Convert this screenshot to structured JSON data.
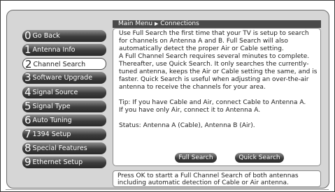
{
  "menu": {
    "items": [
      {
        "number": "0",
        "label": "Go Back"
      },
      {
        "number": "1",
        "label": "Antenna Info"
      },
      {
        "number": "2",
        "label": "Channel Search"
      },
      {
        "number": "3",
        "label": "Software Upgrade"
      },
      {
        "number": "4",
        "label": "Signal Source"
      },
      {
        "number": "5",
        "label": "Signal Type"
      },
      {
        "number": "6",
        "label": "Auto Tuning"
      },
      {
        "number": "7",
        "label": "1394 Setup"
      },
      {
        "number": "8",
        "label": "Special Features"
      },
      {
        "number": "9",
        "label": "Ethernet Setup"
      }
    ],
    "selected": "Channel Search"
  },
  "breadcrumb": {
    "root": "Main Menu",
    "separator": "▶",
    "current": "Connections"
  },
  "content": {
    "paragraph1": "Use Full Search the first time that your TV is setup to search for channels on Antenna A and B. Full Search will also automatically detect the proper Air or Cable setting.",
    "paragraph2": "A Full Channel Search requires several minutes to complete. Thereafter, use Quick Search. It only searches the currently-tuned antenna, keeps the Air or Cable setting the same, and is faster. Quick Search is useful when adjusting an over-the-air antenna to receive the channels for your area.",
    "tip_line1": "Tip: If you have Cable and Air, connect Cable to Antenna A.",
    "tip_line2": "If you have only Air, connect it to Antenna A.",
    "status": "Status: Antenna A (Cable), Antenna B (Air)."
  },
  "buttons": {
    "full_search": "Full Search",
    "quick_search": "Quick Search"
  },
  "help": {
    "line1": "Press OK to startt a Full Channel Search of both antennas",
    "line2": "including automatic detection of Cable or Air antenna."
  }
}
